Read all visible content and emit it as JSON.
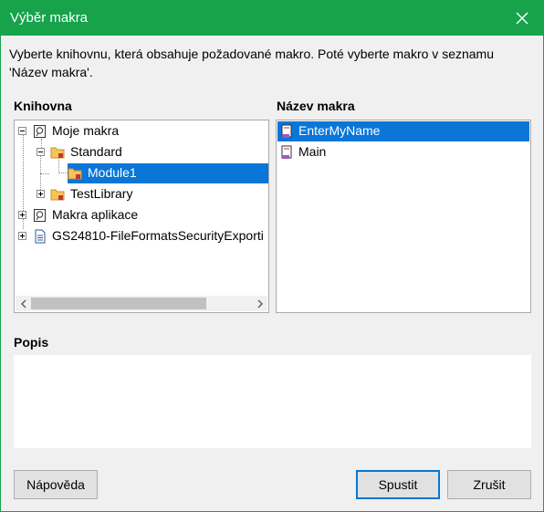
{
  "window": {
    "title": "Výběr makra",
    "accent": "#16a34a",
    "close_icon": "close-icon"
  },
  "description": "Vyberte knihovnu, která obsahuje požadované makro. Poté vyberte makro v seznamu 'Název makra'.",
  "library": {
    "label": "Knihovna",
    "items": [
      {
        "label": "Moje makra",
        "icon": "macro-container-icon",
        "expander": "minus",
        "selected": false
      },
      {
        "label": "Standard",
        "icon": "folder-icon",
        "expander": "minus",
        "selected": false
      },
      {
        "label": "Module1",
        "icon": "module-icon",
        "expander": "none",
        "selected": true
      },
      {
        "label": "TestLibrary",
        "icon": "folder-icon",
        "expander": "plus",
        "selected": false
      },
      {
        "label": "Makra aplikace",
        "icon": "macro-container-icon",
        "expander": "plus",
        "selected": false
      },
      {
        "label": "GS24810-FileFormatsSecurityExporti",
        "icon": "document-icon",
        "expander": "plus",
        "selected": false
      }
    ]
  },
  "macro_list": {
    "label": "Název makra",
    "items": [
      {
        "label": "EnterMyName",
        "icon": "macro-icon",
        "selected": true
      },
      {
        "label": "Main",
        "icon": "macro-icon",
        "selected": false
      }
    ]
  },
  "popis": {
    "label": "Popis",
    "text": ""
  },
  "buttons": {
    "help": "Nápověda",
    "run": "Spustit",
    "cancel": "Zrušit"
  },
  "colors": {
    "selection": "#0a76d8",
    "default_button_border": "#0078d7"
  }
}
